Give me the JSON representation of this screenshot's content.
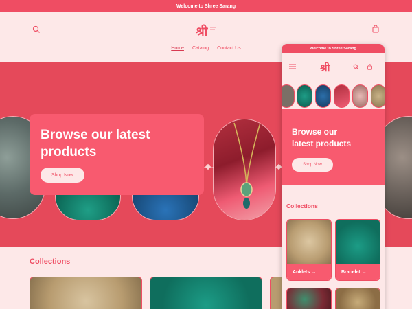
{
  "announcement": {
    "text": "Welcome to Shree Sarang"
  },
  "header": {
    "logo_glyph": "श्री",
    "nav": [
      {
        "label": "Home"
      },
      {
        "label": "Catalog"
      },
      {
        "label": "Contact Us"
      }
    ]
  },
  "hero": {
    "title_line1": "Browse our latest",
    "title_line2": "products",
    "button_label": "Shop Now"
  },
  "collections": {
    "title": "Collections"
  },
  "mobile": {
    "announcement": "Welcome to Shree Sarang",
    "hero_title_line1": "Browse our",
    "hero_title_line2": "latest products",
    "button_label": "Shop Now",
    "collections_title": "Collections",
    "cards": [
      {
        "label": "Anklets →"
      },
      {
        "label": "Bracelet →"
      }
    ]
  },
  "colors": {
    "accent": "#ef4d63",
    "hero_bg": "#e5495a",
    "card_bg": "#f85a6f",
    "page_bg": "#fde8e8"
  }
}
